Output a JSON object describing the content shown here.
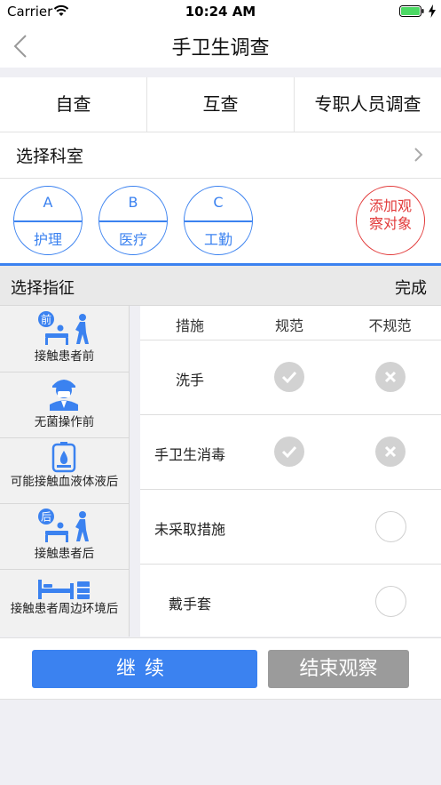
{
  "status_bar": {
    "carrier": "Carrier",
    "time": "10:24 AM"
  },
  "nav": {
    "title": "手卫生调查"
  },
  "tabs": [
    {
      "label": "自查"
    },
    {
      "label": "互查"
    },
    {
      "label": "专职人员调查"
    }
  ],
  "department": {
    "label": "选择科室"
  },
  "categories": [
    {
      "letter": "A",
      "name": "护理"
    },
    {
      "letter": "B",
      "name": "医疗"
    },
    {
      "letter": "C",
      "name": "工勤"
    }
  ],
  "add_observation": {
    "label": "添加观察对象"
  },
  "indication_header": {
    "title": "选择指征",
    "done_label": "完成"
  },
  "indications": [
    {
      "label": "接触患者前",
      "icon": "patient-contact-before-icon",
      "badge": "前"
    },
    {
      "label": "无菌操作前",
      "icon": "doctor-mask-icon"
    },
    {
      "label": "可能接触血液体液后",
      "icon": "blood-bag-icon"
    },
    {
      "label": "接触患者后",
      "icon": "patient-contact-after-icon",
      "badge": "后"
    },
    {
      "label": "接触患者周边环境后",
      "icon": "hospital-bed-icon"
    }
  ],
  "measures": {
    "headers": {
      "measure": "措施",
      "compliant": "规范",
      "noncompliant": "不规范"
    },
    "rows": [
      {
        "name": "洗手",
        "compliant": "check",
        "noncompliant": "cross"
      },
      {
        "name": "手卫生消毒",
        "compliant": "check",
        "noncompliant": "cross"
      },
      {
        "name": "未采取措施",
        "compliant": null,
        "noncompliant": "empty"
      },
      {
        "name": "戴手套",
        "compliant": null,
        "noncompliant": "empty"
      }
    ]
  },
  "buttons": {
    "continue_label": "继续",
    "finish_label": "结束观察"
  },
  "colors": {
    "accent": "#3b82f0",
    "danger": "#e23b3b",
    "secondary": "#9b9b9b"
  }
}
